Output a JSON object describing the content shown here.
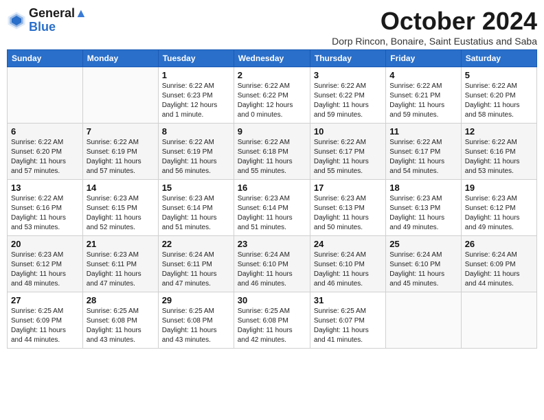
{
  "header": {
    "logo_line1": "General",
    "logo_line2": "Blue",
    "month_title": "October 2024",
    "location": "Dorp Rincon, Bonaire, Saint Eustatius and Saba"
  },
  "weekdays": [
    "Sunday",
    "Monday",
    "Tuesday",
    "Wednesday",
    "Thursday",
    "Friday",
    "Saturday"
  ],
  "weeks": [
    [
      {
        "day": "",
        "info": ""
      },
      {
        "day": "",
        "info": ""
      },
      {
        "day": "1",
        "info": "Sunrise: 6:22 AM\nSunset: 6:23 PM\nDaylight: 12 hours\nand 1 minute."
      },
      {
        "day": "2",
        "info": "Sunrise: 6:22 AM\nSunset: 6:22 PM\nDaylight: 12 hours\nand 0 minutes."
      },
      {
        "day": "3",
        "info": "Sunrise: 6:22 AM\nSunset: 6:22 PM\nDaylight: 11 hours\nand 59 minutes."
      },
      {
        "day": "4",
        "info": "Sunrise: 6:22 AM\nSunset: 6:21 PM\nDaylight: 11 hours\nand 59 minutes."
      },
      {
        "day": "5",
        "info": "Sunrise: 6:22 AM\nSunset: 6:20 PM\nDaylight: 11 hours\nand 58 minutes."
      }
    ],
    [
      {
        "day": "6",
        "info": "Sunrise: 6:22 AM\nSunset: 6:20 PM\nDaylight: 11 hours\nand 57 minutes."
      },
      {
        "day": "7",
        "info": "Sunrise: 6:22 AM\nSunset: 6:19 PM\nDaylight: 11 hours\nand 57 minutes."
      },
      {
        "day": "8",
        "info": "Sunrise: 6:22 AM\nSunset: 6:19 PM\nDaylight: 11 hours\nand 56 minutes."
      },
      {
        "day": "9",
        "info": "Sunrise: 6:22 AM\nSunset: 6:18 PM\nDaylight: 11 hours\nand 55 minutes."
      },
      {
        "day": "10",
        "info": "Sunrise: 6:22 AM\nSunset: 6:17 PM\nDaylight: 11 hours\nand 55 minutes."
      },
      {
        "day": "11",
        "info": "Sunrise: 6:22 AM\nSunset: 6:17 PM\nDaylight: 11 hours\nand 54 minutes."
      },
      {
        "day": "12",
        "info": "Sunrise: 6:22 AM\nSunset: 6:16 PM\nDaylight: 11 hours\nand 53 minutes."
      }
    ],
    [
      {
        "day": "13",
        "info": "Sunrise: 6:22 AM\nSunset: 6:16 PM\nDaylight: 11 hours\nand 53 minutes."
      },
      {
        "day": "14",
        "info": "Sunrise: 6:23 AM\nSunset: 6:15 PM\nDaylight: 11 hours\nand 52 minutes."
      },
      {
        "day": "15",
        "info": "Sunrise: 6:23 AM\nSunset: 6:14 PM\nDaylight: 11 hours\nand 51 minutes."
      },
      {
        "day": "16",
        "info": "Sunrise: 6:23 AM\nSunset: 6:14 PM\nDaylight: 11 hours\nand 51 minutes."
      },
      {
        "day": "17",
        "info": "Sunrise: 6:23 AM\nSunset: 6:13 PM\nDaylight: 11 hours\nand 50 minutes."
      },
      {
        "day": "18",
        "info": "Sunrise: 6:23 AM\nSunset: 6:13 PM\nDaylight: 11 hours\nand 49 minutes."
      },
      {
        "day": "19",
        "info": "Sunrise: 6:23 AM\nSunset: 6:12 PM\nDaylight: 11 hours\nand 49 minutes."
      }
    ],
    [
      {
        "day": "20",
        "info": "Sunrise: 6:23 AM\nSunset: 6:12 PM\nDaylight: 11 hours\nand 48 minutes."
      },
      {
        "day": "21",
        "info": "Sunrise: 6:23 AM\nSunset: 6:11 PM\nDaylight: 11 hours\nand 47 minutes."
      },
      {
        "day": "22",
        "info": "Sunrise: 6:24 AM\nSunset: 6:11 PM\nDaylight: 11 hours\nand 47 minutes."
      },
      {
        "day": "23",
        "info": "Sunrise: 6:24 AM\nSunset: 6:10 PM\nDaylight: 11 hours\nand 46 minutes."
      },
      {
        "day": "24",
        "info": "Sunrise: 6:24 AM\nSunset: 6:10 PM\nDaylight: 11 hours\nand 46 minutes."
      },
      {
        "day": "25",
        "info": "Sunrise: 6:24 AM\nSunset: 6:10 PM\nDaylight: 11 hours\nand 45 minutes."
      },
      {
        "day": "26",
        "info": "Sunrise: 6:24 AM\nSunset: 6:09 PM\nDaylight: 11 hours\nand 44 minutes."
      }
    ],
    [
      {
        "day": "27",
        "info": "Sunrise: 6:25 AM\nSunset: 6:09 PM\nDaylight: 11 hours\nand 44 minutes."
      },
      {
        "day": "28",
        "info": "Sunrise: 6:25 AM\nSunset: 6:08 PM\nDaylight: 11 hours\nand 43 minutes."
      },
      {
        "day": "29",
        "info": "Sunrise: 6:25 AM\nSunset: 6:08 PM\nDaylight: 11 hours\nand 43 minutes."
      },
      {
        "day": "30",
        "info": "Sunrise: 6:25 AM\nSunset: 6:08 PM\nDaylight: 11 hours\nand 42 minutes."
      },
      {
        "day": "31",
        "info": "Sunrise: 6:25 AM\nSunset: 6:07 PM\nDaylight: 11 hours\nand 41 minutes."
      },
      {
        "day": "",
        "info": ""
      },
      {
        "day": "",
        "info": ""
      }
    ]
  ]
}
